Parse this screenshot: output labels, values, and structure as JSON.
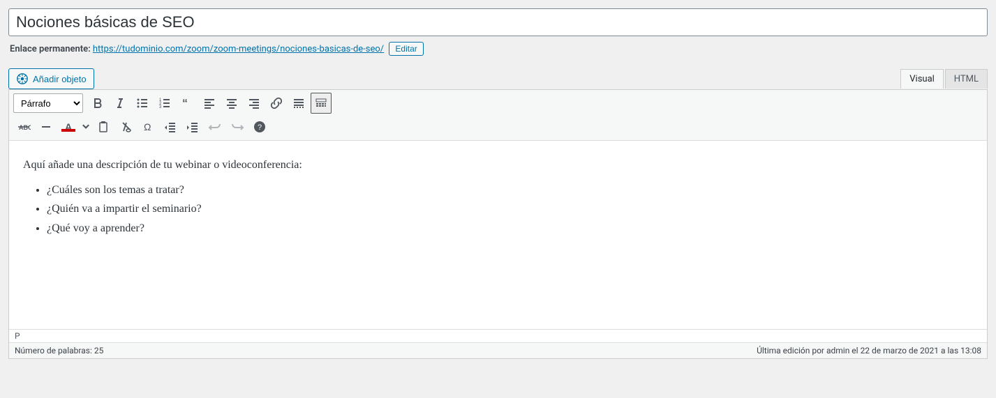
{
  "title": "Nociones básicas de SEO",
  "permalink": {
    "label": "Enlace permanente:",
    "base": "https://tudominio.com/zoom/zoom-meetings/",
    "slug": "nociones-basicas-de-seo/",
    "edit_label": "Editar"
  },
  "add_object_label": "Añadir objeto",
  "tabs": {
    "visual": "Visual",
    "html": "HTML"
  },
  "format_select": "Párrafo",
  "content": {
    "intro": "Aquí añade una descripción de tu webinar o videoconferencia:",
    "items": [
      "¿Cuáles son los temas a tratar?",
      "¿Quién va a impartir el seminario?",
      "¿Qué voy a aprender?"
    ]
  },
  "path": "P",
  "status": {
    "wordcount_label": "Número de palabras:",
    "wordcount": "25",
    "lastedit": "Última edición por admin el 22 de marzo de 2021 a las 13:08"
  }
}
